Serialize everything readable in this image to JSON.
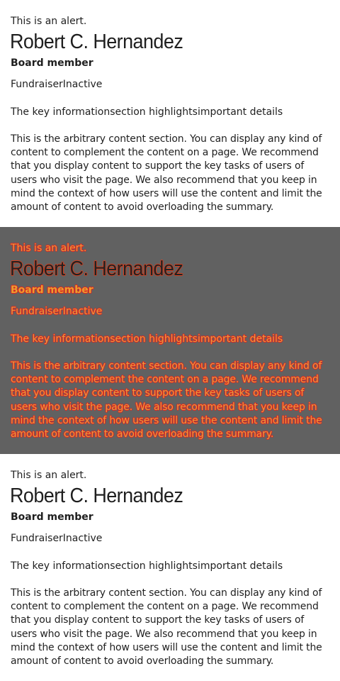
{
  "panels": [
    {
      "alert": "This is an alert.",
      "name": "Robert C. Hernandez",
      "role": "Board member",
      "tags": "FundraiserInactive",
      "key_info": "The key informationsection highlightsimportant details",
      "arbitrary": "This is the arbitrary content section. You can display any kind of content to complement the content on a page. We recommend that you display content to support the key tasks of users of users who visit the page. We also recommend that you keep in mind the context of how users will use the content and limit the amount of content to avoid overloading the summary."
    },
    {
      "alert": "This is an alert.",
      "name": "Robert C. Hernandez",
      "role": "Board member",
      "tags": "FundraiserInactive",
      "key_info": "The key informationsection highlightsimportant details",
      "arbitrary": "This is the arbitrary content section. You can display any kind of content to complement the content on a page. We recommend that you display content to support the key tasks of users of users who visit the page. We also recommend that you keep in mind the context of how users will use the content and limit the amount of content to avoid overloading the summary."
    },
    {
      "alert": "This is an alert.",
      "name": "Robert C. Hernandez",
      "role": "Board member",
      "tags": "FundraiserInactive",
      "key_info": "The key informationsection highlightsimportant details",
      "arbitrary": "This is the arbitrary content section. You can display any kind of content to complement the content on a page. We recommend that you display content to support the key tasks of users of users who visit the page. We also recommend that you keep in mind the context of how users will use the content and limit the amount of content to avoid overloading the summary."
    }
  ],
  "colors": {
    "light_bg": "#ffffff",
    "dark_bg": "#616161",
    "text": "#1f1f1f",
    "outline_red": "#e02020",
    "outline_orange": "#e0a040"
  }
}
